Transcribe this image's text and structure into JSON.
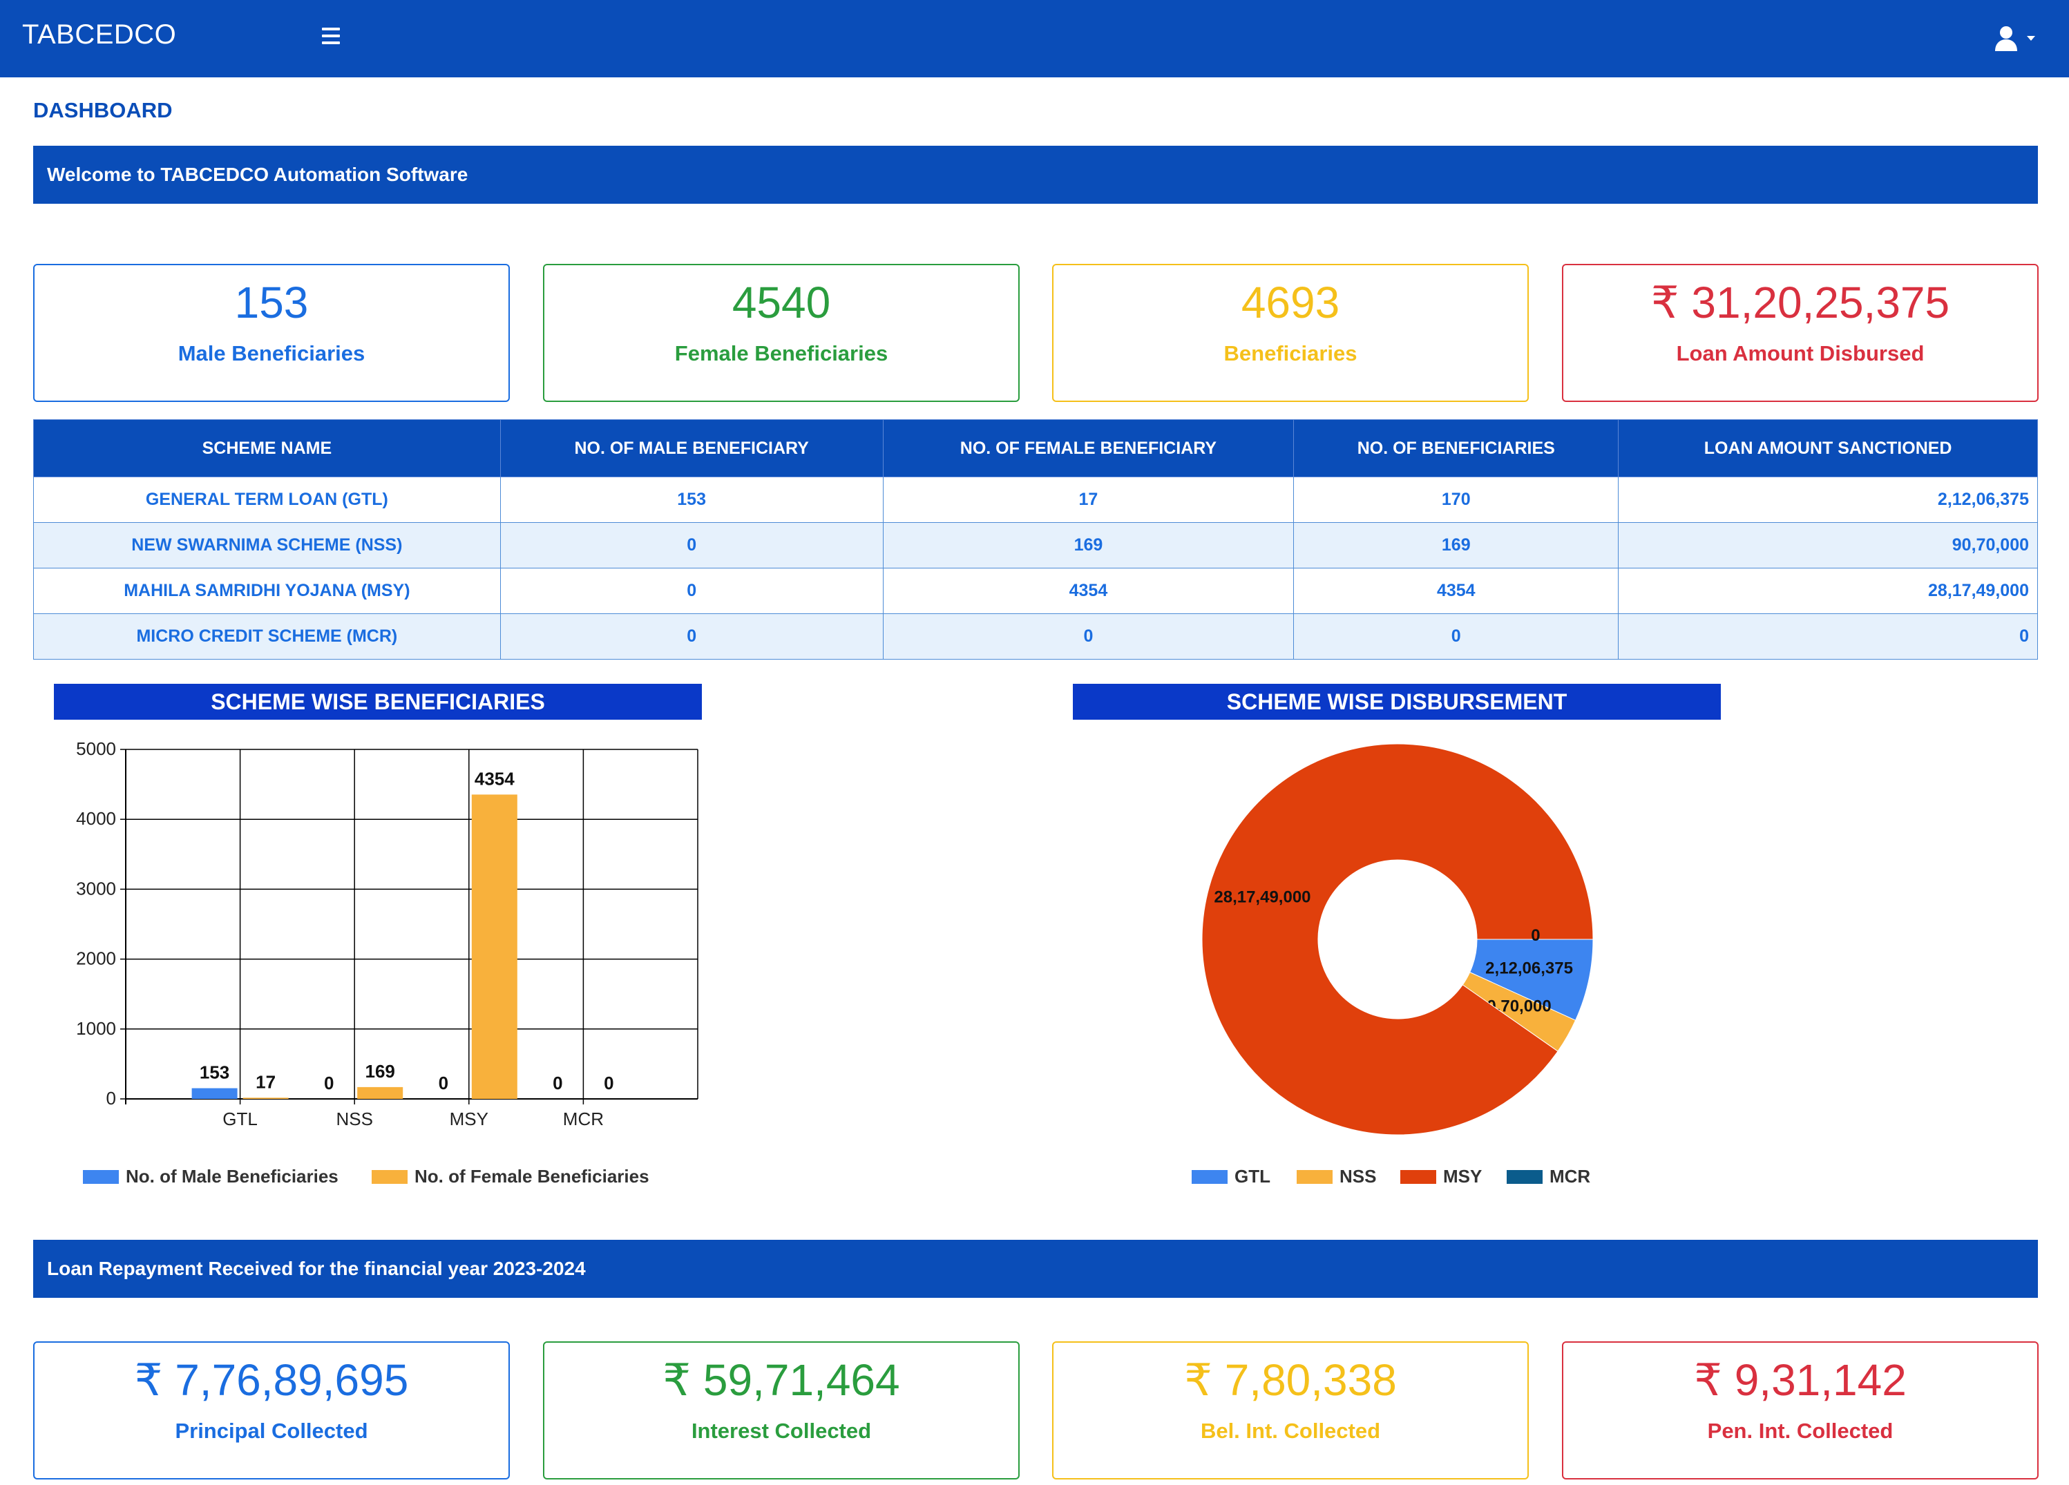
{
  "app": {
    "brand": "TABCEDCO"
  },
  "page": {
    "title": "DASHBOARD"
  },
  "welcome": {
    "text": "Welcome to TABCEDCO Automation Software"
  },
  "stats": [
    {
      "value": "153",
      "label": "Male Beneficiaries",
      "color": "#1a6de0"
    },
    {
      "value": "4540",
      "label": "Female Beneficiaries",
      "color": "#2a9d3e"
    },
    {
      "value": "4693",
      "label": "Beneficiaries",
      "color": "#f5c01a"
    },
    {
      "value": "₹ 31,20,25,375",
      "label": "Loan Amount Disbursed",
      "color": "#d9303f"
    }
  ],
  "table": {
    "headers": [
      "SCHEME NAME",
      "NO. OF MALE BENEFICIARY",
      "NO. OF FEMALE BENEFICIARY",
      "NO. OF BENEFICIARIES",
      "LOAN AMOUNT SANCTIONED"
    ],
    "rows": [
      [
        "GENERAL TERM LOAN (GTL)",
        "153",
        "17",
        "170",
        "2,12,06,375"
      ],
      [
        "NEW SWARNIMA SCHEME (NSS)",
        "0",
        "169",
        "169",
        "90,70,000"
      ],
      [
        "MAHILA SAMRIDHI YOJANA (MSY)",
        "0",
        "4354",
        "4354",
        "28,17,49,000"
      ],
      [
        "MICRO CREDIT SCHEME (MCR)",
        "0",
        "0",
        "0",
        "0"
      ]
    ]
  },
  "bar_title": "SCHEME WISE BENEFICIARIES",
  "pie_title": "SCHEME WISE DISBURSEMENT",
  "chart_data": [
    {
      "type": "bar",
      "title": "SCHEME WISE BENEFICIARIES",
      "categories": [
        "GTL",
        "NSS",
        "MSY",
        "MCR"
      ],
      "series": [
        {
          "name": "No. of Male Beneficiaries",
          "values": [
            153,
            0,
            0,
            0
          ],
          "color": "#3d85f0"
        },
        {
          "name": "No. of Female Beneficiaries",
          "values": [
            17,
            169,
            4354,
            0
          ],
          "color": "#f8b13c"
        }
      ],
      "ylim": [
        0,
        5000
      ],
      "yticks": [
        0,
        1000,
        2000,
        3000,
        4000,
        5000
      ],
      "grid": true,
      "legend": "bottom"
    },
    {
      "type": "pie",
      "title": "SCHEME WISE DISBURSEMENT",
      "donut": true,
      "slices": [
        {
          "name": "GTL",
          "value": 21206375,
          "label": "2,12,06,375",
          "color": "#3d85f0"
        },
        {
          "name": "NSS",
          "value": 9070000,
          "label": "90,70,000",
          "color": "#f8b13c"
        },
        {
          "name": "MSY",
          "value": 281749000,
          "label": "28,17,49,000",
          "color": "#e0400c"
        },
        {
          "name": "MCR",
          "value": 0,
          "label": "0",
          "color": "#0b5c8c"
        }
      ],
      "legend": "bottom"
    }
  ],
  "repayment": {
    "text": "Loan Repayment Received for the financial year 2023-2024"
  },
  "collections": [
    {
      "value": "₹ 7,76,89,695",
      "label": "Principal Collected"
    },
    {
      "value": "₹ 59,71,464",
      "label": "Interest Collected"
    },
    {
      "value": "₹ 7,80,338",
      "label": "Bel. Int. Collected"
    },
    {
      "value": "₹ 9,31,142",
      "label": "Pen. Int. Collected"
    }
  ]
}
